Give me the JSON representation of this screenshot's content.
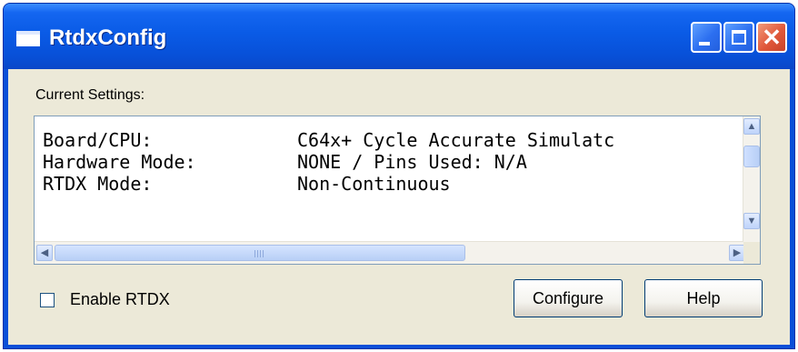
{
  "window": {
    "title": "RtdxConfig"
  },
  "caption_buttons": {
    "minimize": "_",
    "maximize": "□",
    "close": "✕"
  },
  "panel": {
    "label": "Current Settings:"
  },
  "settings": [
    {
      "key": "Board/CPU:",
      "value": "C64x+ Cycle Accurate Simulatc"
    },
    {
      "key": "Hardware Mode:",
      "value": "NONE / Pins Used: N/A"
    },
    {
      "key": "RTDX Mode:",
      "value": "Non-Continuous"
    }
  ],
  "scrollbars": {
    "up": "▲",
    "down": "▼",
    "left": "◀",
    "right": "▶",
    "vertical_position": 0.0,
    "horizontal_position": 0.0,
    "horizontal_visible_fraction": 0.6
  },
  "enable_rtdx": {
    "label": "Enable RTDX",
    "checked": false
  },
  "buttons": {
    "configure": "Configure",
    "help": "Help"
  },
  "colors": {
    "titlebar": "#0a5be6",
    "window_face": "#ece9d8",
    "close_button": "#e0583a",
    "list_border": "#7f9db9"
  }
}
